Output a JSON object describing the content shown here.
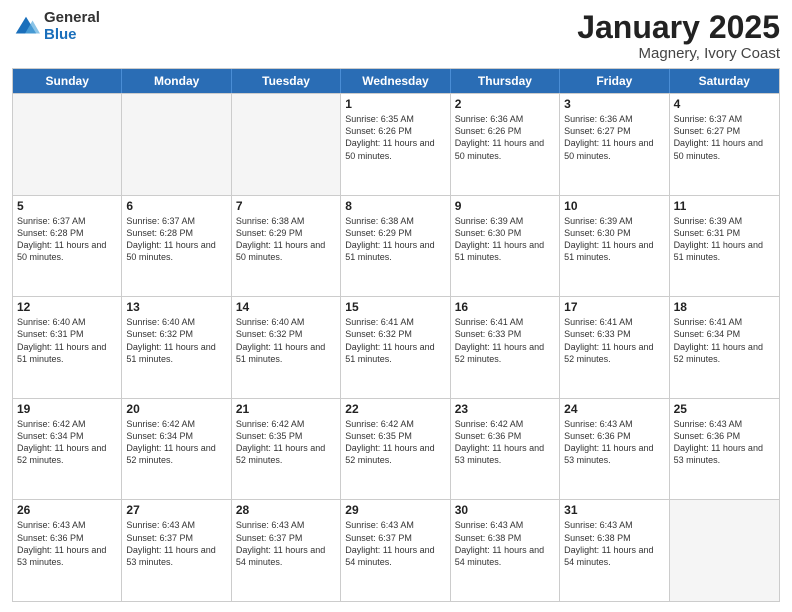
{
  "logo": {
    "general": "General",
    "blue": "Blue"
  },
  "title": {
    "month": "January 2025",
    "location": "Magnery, Ivory Coast"
  },
  "header": {
    "days": [
      "Sunday",
      "Monday",
      "Tuesday",
      "Wednesday",
      "Thursday",
      "Friday",
      "Saturday"
    ]
  },
  "weeks": [
    [
      {
        "day": "",
        "sunrise": "",
        "sunset": "",
        "daylight": ""
      },
      {
        "day": "",
        "sunrise": "",
        "sunset": "",
        "daylight": ""
      },
      {
        "day": "",
        "sunrise": "",
        "sunset": "",
        "daylight": ""
      },
      {
        "day": "1",
        "sunrise": "Sunrise: 6:35 AM",
        "sunset": "Sunset: 6:26 PM",
        "daylight": "Daylight: 11 hours and 50 minutes."
      },
      {
        "day": "2",
        "sunrise": "Sunrise: 6:36 AM",
        "sunset": "Sunset: 6:26 PM",
        "daylight": "Daylight: 11 hours and 50 minutes."
      },
      {
        "day": "3",
        "sunrise": "Sunrise: 6:36 AM",
        "sunset": "Sunset: 6:27 PM",
        "daylight": "Daylight: 11 hours and 50 minutes."
      },
      {
        "day": "4",
        "sunrise": "Sunrise: 6:37 AM",
        "sunset": "Sunset: 6:27 PM",
        "daylight": "Daylight: 11 hours and 50 minutes."
      }
    ],
    [
      {
        "day": "5",
        "sunrise": "Sunrise: 6:37 AM",
        "sunset": "Sunset: 6:28 PM",
        "daylight": "Daylight: 11 hours and 50 minutes."
      },
      {
        "day": "6",
        "sunrise": "Sunrise: 6:37 AM",
        "sunset": "Sunset: 6:28 PM",
        "daylight": "Daylight: 11 hours and 50 minutes."
      },
      {
        "day": "7",
        "sunrise": "Sunrise: 6:38 AM",
        "sunset": "Sunset: 6:29 PM",
        "daylight": "Daylight: 11 hours and 50 minutes."
      },
      {
        "day": "8",
        "sunrise": "Sunrise: 6:38 AM",
        "sunset": "Sunset: 6:29 PM",
        "daylight": "Daylight: 11 hours and 51 minutes."
      },
      {
        "day": "9",
        "sunrise": "Sunrise: 6:39 AM",
        "sunset": "Sunset: 6:30 PM",
        "daylight": "Daylight: 11 hours and 51 minutes."
      },
      {
        "day": "10",
        "sunrise": "Sunrise: 6:39 AM",
        "sunset": "Sunset: 6:30 PM",
        "daylight": "Daylight: 11 hours and 51 minutes."
      },
      {
        "day": "11",
        "sunrise": "Sunrise: 6:39 AM",
        "sunset": "Sunset: 6:31 PM",
        "daylight": "Daylight: 11 hours and 51 minutes."
      }
    ],
    [
      {
        "day": "12",
        "sunrise": "Sunrise: 6:40 AM",
        "sunset": "Sunset: 6:31 PM",
        "daylight": "Daylight: 11 hours and 51 minutes."
      },
      {
        "day": "13",
        "sunrise": "Sunrise: 6:40 AM",
        "sunset": "Sunset: 6:32 PM",
        "daylight": "Daylight: 11 hours and 51 minutes."
      },
      {
        "day": "14",
        "sunrise": "Sunrise: 6:40 AM",
        "sunset": "Sunset: 6:32 PM",
        "daylight": "Daylight: 11 hours and 51 minutes."
      },
      {
        "day": "15",
        "sunrise": "Sunrise: 6:41 AM",
        "sunset": "Sunset: 6:32 PM",
        "daylight": "Daylight: 11 hours and 51 minutes."
      },
      {
        "day": "16",
        "sunrise": "Sunrise: 6:41 AM",
        "sunset": "Sunset: 6:33 PM",
        "daylight": "Daylight: 11 hours and 52 minutes."
      },
      {
        "day": "17",
        "sunrise": "Sunrise: 6:41 AM",
        "sunset": "Sunset: 6:33 PM",
        "daylight": "Daylight: 11 hours and 52 minutes."
      },
      {
        "day": "18",
        "sunrise": "Sunrise: 6:41 AM",
        "sunset": "Sunset: 6:34 PM",
        "daylight": "Daylight: 11 hours and 52 minutes."
      }
    ],
    [
      {
        "day": "19",
        "sunrise": "Sunrise: 6:42 AM",
        "sunset": "Sunset: 6:34 PM",
        "daylight": "Daylight: 11 hours and 52 minutes."
      },
      {
        "day": "20",
        "sunrise": "Sunrise: 6:42 AM",
        "sunset": "Sunset: 6:34 PM",
        "daylight": "Daylight: 11 hours and 52 minutes."
      },
      {
        "day": "21",
        "sunrise": "Sunrise: 6:42 AM",
        "sunset": "Sunset: 6:35 PM",
        "daylight": "Daylight: 11 hours and 52 minutes."
      },
      {
        "day": "22",
        "sunrise": "Sunrise: 6:42 AM",
        "sunset": "Sunset: 6:35 PM",
        "daylight": "Daylight: 11 hours and 52 minutes."
      },
      {
        "day": "23",
        "sunrise": "Sunrise: 6:42 AM",
        "sunset": "Sunset: 6:36 PM",
        "daylight": "Daylight: 11 hours and 53 minutes."
      },
      {
        "day": "24",
        "sunrise": "Sunrise: 6:43 AM",
        "sunset": "Sunset: 6:36 PM",
        "daylight": "Daylight: 11 hours and 53 minutes."
      },
      {
        "day": "25",
        "sunrise": "Sunrise: 6:43 AM",
        "sunset": "Sunset: 6:36 PM",
        "daylight": "Daylight: 11 hours and 53 minutes."
      }
    ],
    [
      {
        "day": "26",
        "sunrise": "Sunrise: 6:43 AM",
        "sunset": "Sunset: 6:36 PM",
        "daylight": "Daylight: 11 hours and 53 minutes."
      },
      {
        "day": "27",
        "sunrise": "Sunrise: 6:43 AM",
        "sunset": "Sunset: 6:37 PM",
        "daylight": "Daylight: 11 hours and 53 minutes."
      },
      {
        "day": "28",
        "sunrise": "Sunrise: 6:43 AM",
        "sunset": "Sunset: 6:37 PM",
        "daylight": "Daylight: 11 hours and 54 minutes."
      },
      {
        "day": "29",
        "sunrise": "Sunrise: 6:43 AM",
        "sunset": "Sunset: 6:37 PM",
        "daylight": "Daylight: 11 hours and 54 minutes."
      },
      {
        "day": "30",
        "sunrise": "Sunrise: 6:43 AM",
        "sunset": "Sunset: 6:38 PM",
        "daylight": "Daylight: 11 hours and 54 minutes."
      },
      {
        "day": "31",
        "sunrise": "Sunrise: 6:43 AM",
        "sunset": "Sunset: 6:38 PM",
        "daylight": "Daylight: 11 hours and 54 minutes."
      },
      {
        "day": "",
        "sunrise": "",
        "sunset": "",
        "daylight": ""
      }
    ]
  ]
}
